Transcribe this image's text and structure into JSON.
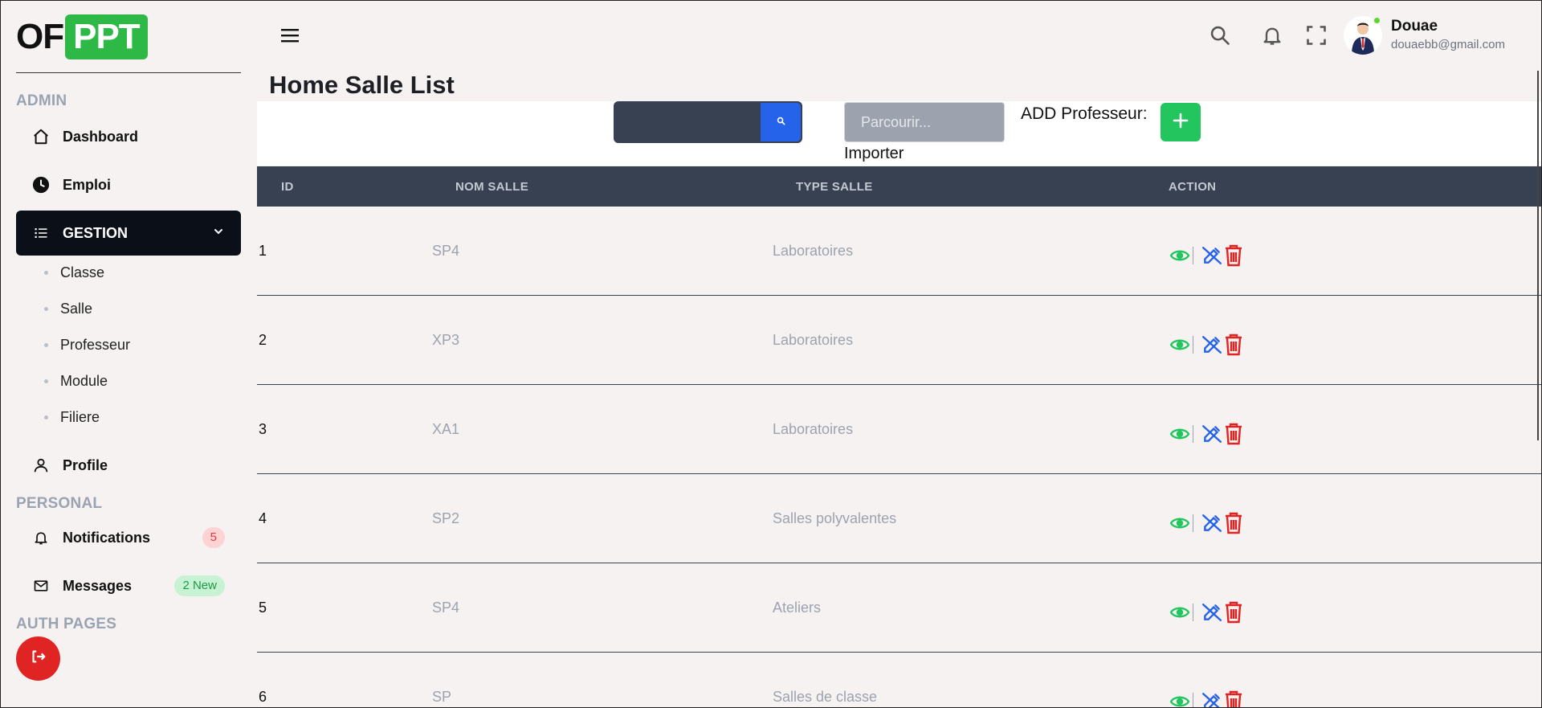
{
  "logo": {
    "part1": "OF",
    "part2": "PPT"
  },
  "sidebar": {
    "sections": {
      "admin": "ADMIN",
      "personal": "PERSONAL",
      "auth": "AUTH PAGES"
    },
    "items": {
      "dashboard": "Dashboard",
      "emploi": "Emploi",
      "gestion": "GESTION",
      "profile": "Profile",
      "notifications": "Notifications",
      "messages": "Messages"
    },
    "gestion_sub": [
      "Classe",
      "Salle",
      "Professeur",
      "Module",
      "Filiere"
    ],
    "badges": {
      "notifications": "5",
      "messages": "2 New"
    }
  },
  "user": {
    "name": "Douae",
    "email": "douaebb@gmail.com"
  },
  "page": {
    "title": "Home Salle List"
  },
  "toolbar": {
    "search_placeholder": "",
    "file_placeholder": "Parcourir...",
    "import_label": "Importer",
    "add_label": "ADD Professeur:"
  },
  "table": {
    "headers": {
      "id": "ID",
      "nom": "NOM SALLE",
      "type": "TYPE SALLE",
      "action": "ACTION"
    },
    "rows": [
      {
        "id": "1",
        "nom": "SP4",
        "type": "Laboratoires"
      },
      {
        "id": "2",
        "nom": "XP3",
        "type": "Laboratoires"
      },
      {
        "id": "3",
        "nom": "XA1",
        "type": "Laboratoires"
      },
      {
        "id": "4",
        "nom": "SP2",
        "type": "Salles polyvalentes"
      },
      {
        "id": "5",
        "nom": "SP4",
        "type": "Ateliers"
      },
      {
        "id": "6",
        "nom": "SP",
        "type": "Salles de classe"
      }
    ]
  },
  "colors": {
    "accent_green": "#22c55e",
    "accent_blue": "#2563eb",
    "danger": "#e02424",
    "dark": "#374151"
  }
}
